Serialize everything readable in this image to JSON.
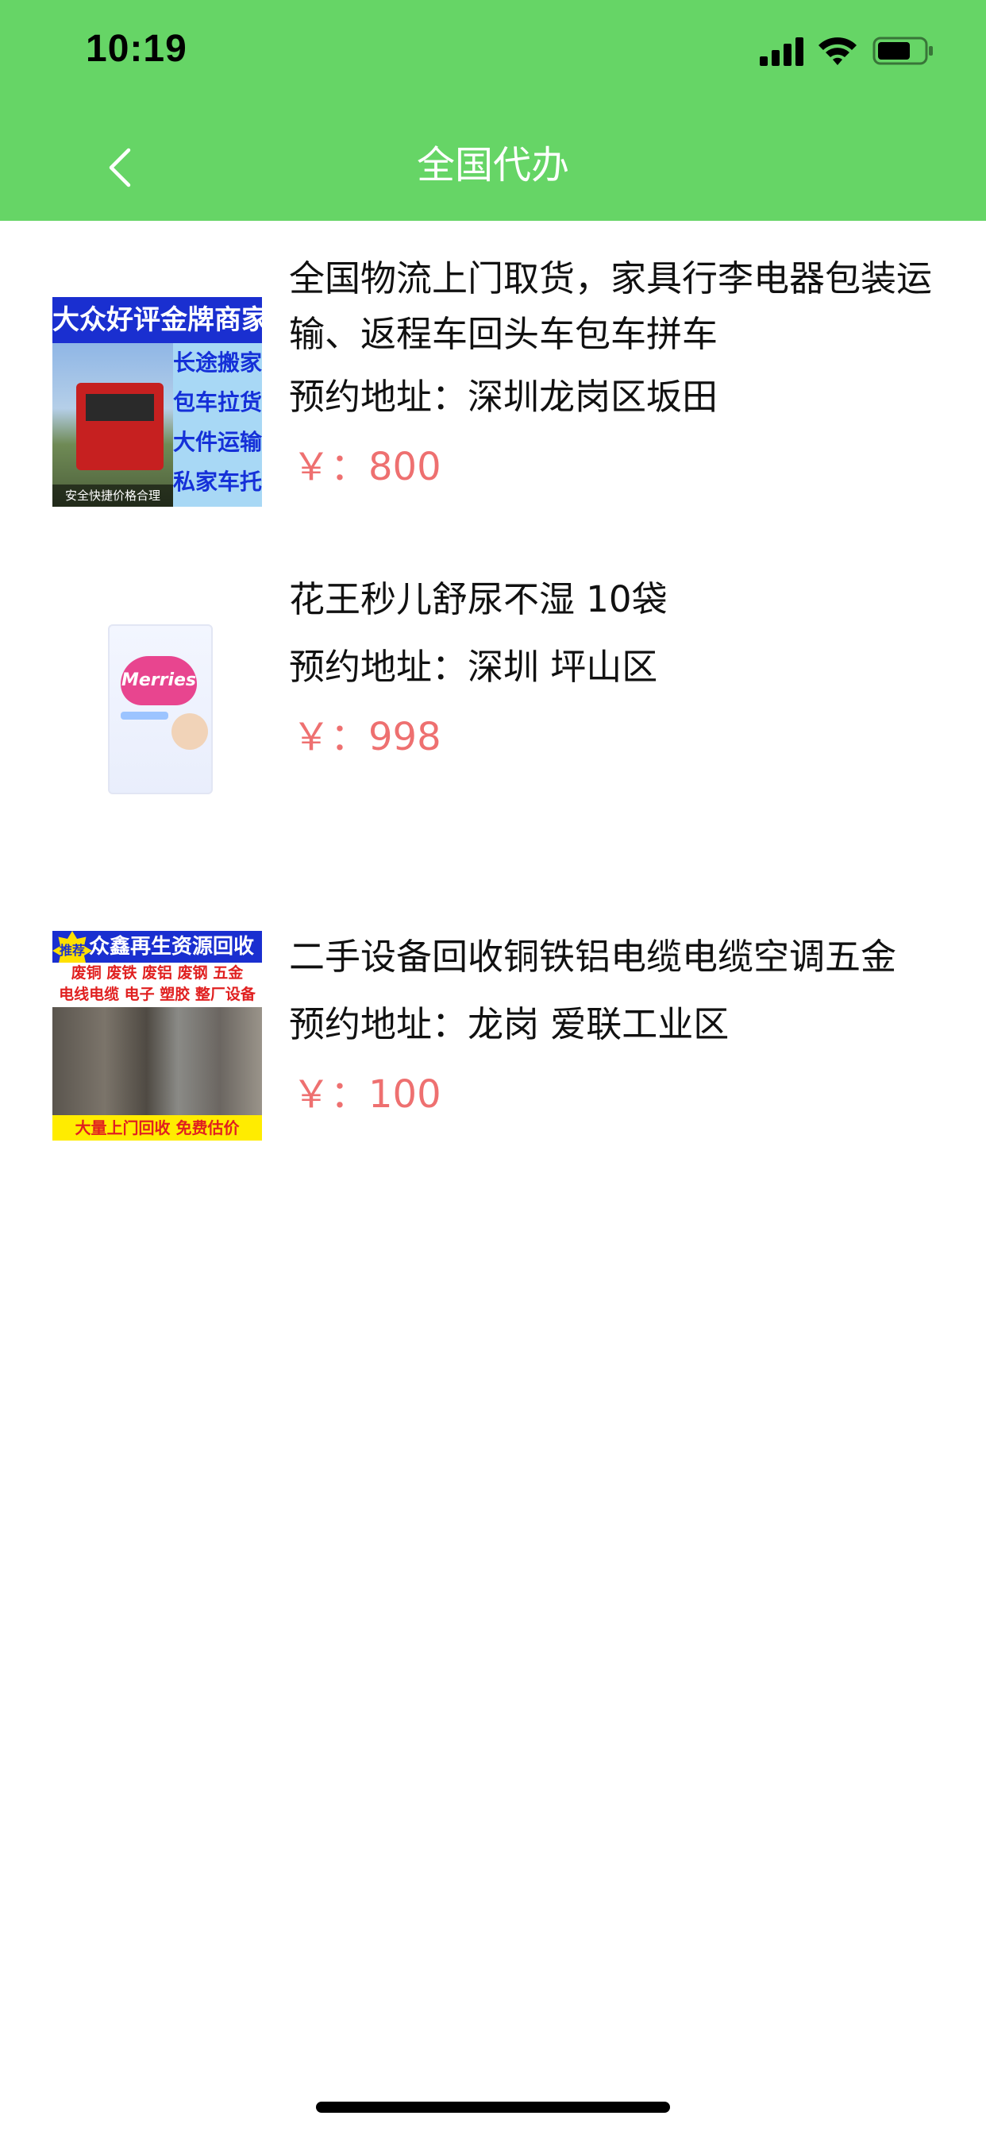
{
  "status_bar": {
    "time": "10:19",
    "icons": [
      "signal-icon",
      "wifi-icon",
      "battery-icon"
    ]
  },
  "nav": {
    "title": "全国代办",
    "back_icon": "chevron-left-icon"
  },
  "colors": {
    "header_bg": "#66d566",
    "price": "#ee7070",
    "text": "#111111"
  },
  "items": [
    {
      "title": "全国物流上门取货，家具行李电器包装运输、返程车回头车包车拼车",
      "address": "预约地址：深圳龙岗区坂田",
      "price": "￥：800",
      "thumb": {
        "top": "大众好评金牌商家",
        "side": [
          "长途搬家",
          "包车拉货",
          "大件运输",
          "私家车托运"
        ],
        "bottom": "安全快捷价格合理"
      }
    },
    {
      "title": "花王秒儿舒尿不湿 10袋",
      "address": "预约地址：深圳 坪山区",
      "price": "￥：998",
      "thumb": {
        "brand": "Merries"
      }
    },
    {
      "title": "二手设备回收铜铁铝电缆电缆空调五金",
      "address": "预约地址：龙岗 爱联工业区",
      "price": "￥：100",
      "thumb": {
        "badge": "推荐",
        "top": "众鑫再生资源回收",
        "line1": "废铜 废铁 废铝 废钢 五金",
        "line2": "电线电缆 电子 塑胶 整厂设备",
        "bottom": "大量上门回收  免费估价"
      }
    }
  ]
}
